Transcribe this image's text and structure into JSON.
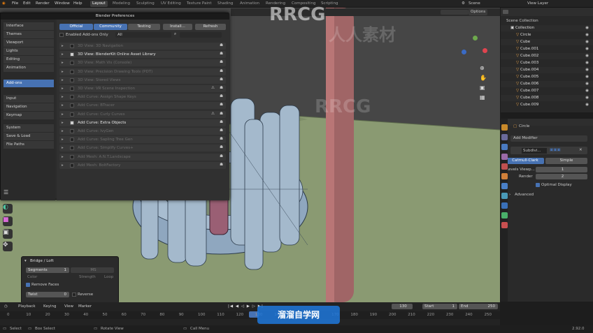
{
  "menu": [
    "File",
    "Edit",
    "Render",
    "Window",
    "Help"
  ],
  "workspaces": [
    "Layout",
    "Modeling",
    "Sculpting",
    "UV Editing",
    "Texture Paint",
    "Shading",
    "Animation",
    "Rendering",
    "Compositing",
    "Scripting"
  ],
  "scene": {
    "label": "Scene",
    "view_layer": "View Layer"
  },
  "viewport_header": {
    "options": "Options"
  },
  "prefs": {
    "title": "Blender Preferences",
    "sidebar": [
      "Interface",
      "Themes",
      "Viewport",
      "Lights",
      "Editing",
      "Animation",
      "Add-ons",
      "Input",
      "Navigation",
      "Keymap",
      "System",
      "Save & Load",
      "File Paths"
    ],
    "active_section": "Add-ons",
    "tabs": [
      "Official",
      "Community",
      "Testing"
    ],
    "install_label": "Install...",
    "refresh_label": "Refresh",
    "enabled_only": "Enabled Add-ons Only",
    "filter_value": "All",
    "addons": [
      {
        "name": "3D View: 3D Navigation",
        "enabled": false,
        "warn": false
      },
      {
        "name": "3D View: BlenderKit Online Asset Library",
        "enabled": true,
        "warn": false
      },
      {
        "name": "3D View: Math Vis (Console)",
        "enabled": false,
        "warn": false
      },
      {
        "name": "3D View: Precision Drawing Tools (PDT)",
        "enabled": false,
        "warn": false
      },
      {
        "name": "3D View: Stored Views",
        "enabled": false,
        "warn": false
      },
      {
        "name": "3D View: VR Scene Inspection",
        "enabled": false,
        "warn": true
      },
      {
        "name": "Add Curve: Assign Shape Keys",
        "enabled": false,
        "warn": false
      },
      {
        "name": "Add Curve: BTracer",
        "enabled": false,
        "warn": false
      },
      {
        "name": "Add Curve: Curly Curves",
        "enabled": false,
        "warn": true
      },
      {
        "name": "Add Curve: Extra Objects",
        "enabled": true,
        "warn": false
      },
      {
        "name": "Add Curve: IvyGen",
        "enabled": false,
        "warn": false
      },
      {
        "name": "Add Curve: Sapling Tree Gen",
        "enabled": false,
        "warn": false
      },
      {
        "name": "Add Curve: Simplify Curves+",
        "enabled": false,
        "warn": false
      },
      {
        "name": "Add Mesh: A.N.T.Landscape",
        "enabled": false,
        "warn": false
      },
      {
        "name": "Add Mesh: BoltFactory",
        "enabled": false,
        "warn": false
      }
    ]
  },
  "outliner": {
    "title": "Scene Collection",
    "items": [
      "Collection",
      "Circle",
      "Cube",
      "Cube.001",
      "Cube.002",
      "Cube.003",
      "Cube.004",
      "Cube.005",
      "Cube.006",
      "Cube.007",
      "Cube.008",
      "Cube.009"
    ]
  },
  "properties": {
    "object": "Circle",
    "add_modifier": "Add Modifier",
    "modifier_name": "Subdivi...",
    "catmull": "Catmull-Clark",
    "simple": "Simple",
    "levels_label": "Levels Viewp...",
    "levels_value": "1",
    "render_label": "Render",
    "render_value": "2",
    "optimal": "Optimal Display",
    "advanced": "Advanced"
  },
  "last_op": {
    "title": "Bridge / Loft",
    "segments_label": "Segments",
    "segments_value": "1",
    "ms_label": "MS",
    "color_label": "Color",
    "strength": "Strength",
    "loop": "Loop",
    "remove_faces": "Remove Faces",
    "twist_label": "Twist",
    "twist_value": "0",
    "reverse": "Reverse"
  },
  "timeline": {
    "menus": [
      "Playback",
      "Keying",
      "View",
      "Marker"
    ],
    "current": "130",
    "start_label": "Start",
    "start": "1",
    "end_label": "End",
    "end": "250",
    "ticks": [
      "0",
      "10",
      "20",
      "30",
      "40",
      "50",
      "60",
      "70",
      "80",
      "90",
      "100",
      "110",
      "120",
      "130",
      "140",
      "150",
      "160",
      "170",
      "180",
      "190",
      "200",
      "210",
      "220",
      "230",
      "240",
      "250"
    ]
  },
  "status": {
    "select": "Select",
    "box": "Box Select",
    "rotate": "Rotate View",
    "call": "Call Menu",
    "version": "2.92.0"
  },
  "watermarks": {
    "top": "RRCG",
    "mid": "RRCG",
    "cn1": "人人素材",
    "logo": "溜溜自学网"
  },
  "colors": {
    "accent": "#4772b3",
    "ground": "#8a9a72",
    "pillar": "#a06566",
    "mesh": "#9fb4c8"
  }
}
